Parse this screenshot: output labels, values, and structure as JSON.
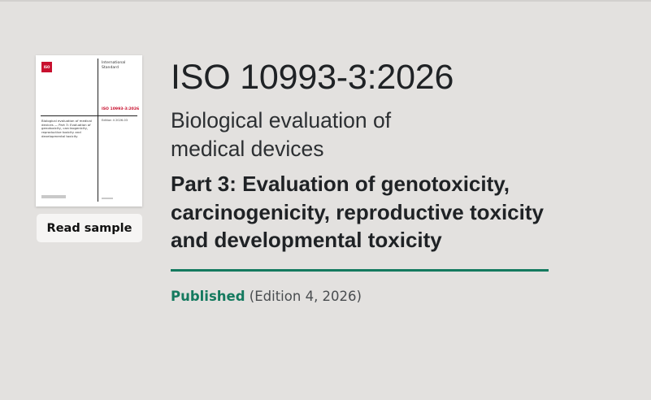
{
  "standard": {
    "reference": "ISO 10993-3:2026",
    "title_line1": "Biological evaluation of",
    "title_line2": "medical devices",
    "part_line1": "Part 3: Evaluation of genotoxicity,",
    "part_line2": "carcinogenicity, reproductive toxicity",
    "part_line3": "and developmental toxicity"
  },
  "cover": {
    "logo_text": "ISO",
    "doc_type": "International Standard",
    "reference": "ISO 10993-3:2026",
    "edition": "Edition 4 2026-03",
    "title": "Biological evaluation of medical devices — Part 3: Evaluation of genotoxicity, carcinogenicity, reproductive toxicity and developmental toxicity"
  },
  "actions": {
    "read_sample": "Read sample"
  },
  "status": {
    "label": "Published",
    "detail": "(Edition 4, 2026)"
  },
  "colors": {
    "accent": "#157a5f",
    "iso_red": "#c8102e",
    "background": "#e3e1df"
  }
}
